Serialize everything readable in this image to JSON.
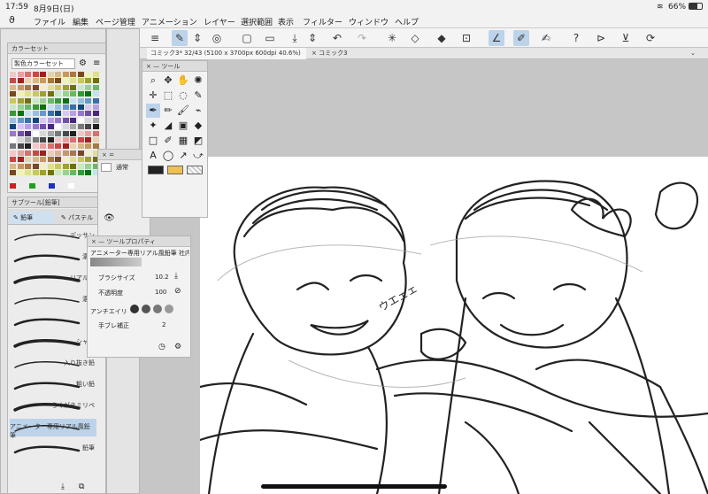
{
  "status": {
    "time": "17:59",
    "date": "8月9日(日)",
    "battery": "66%"
  },
  "menu": {
    "items": [
      "ファイル",
      "編集",
      "ページ管理",
      "アニメーション",
      "レイヤー",
      "選択範囲",
      "表示",
      "フィルター",
      "ウィンドウ",
      "ヘルプ"
    ]
  },
  "tabs": [
    {
      "label": "コミック3* 32/43 (5100 x 3700px 600dpi 40.6%)"
    },
    {
      "label": "コミック3"
    }
  ],
  "color_set": {
    "title": "カラーセット",
    "selector": "製色カラーセット",
    "colors": [
      "#f0c8c8",
      "#e8a0a0",
      "#d87070",
      "#c84848",
      "#a02020",
      "#e8d0b0",
      "#d8b888",
      "#c89860",
      "#a87840",
      "#784820",
      "#f0f0c0",
      "#e0e090",
      "#c8c860",
      "#a0a030",
      "#707010",
      "#c8e8c8",
      "#98d098",
      "#68b868",
      "#389838",
      "#107010",
      "#c8e0f0",
      "#98c0e0",
      "#6898c8",
      "#3870a8",
      "#104878",
      "#d8c8f0",
      "#b8a0e0",
      "#9878c8",
      "#7050a8",
      "#482878",
      "#ffffff",
      "#d8d8d8",
      "#a8a8a8",
      "#787878",
      "#484848",
      "#202020"
    ],
    "bottom_colors": [
      "#cc2020",
      "#20a020",
      "#2030c0",
      "#ffffff"
    ]
  },
  "subtool": {
    "title": "サブツール[鉛筆]",
    "tab_pencil": "鉛筆",
    "tab_pastel": "パステル",
    "brushes": [
      {
        "label": "デッサン"
      },
      {
        "label": "濃い"
      },
      {
        "label": "リアル鉛"
      },
      {
        "label": "濃い"
      },
      {
        "label": "色"
      },
      {
        "label": "シャー"
      },
      {
        "label": "入り抜き鉛"
      },
      {
        "label": "粗い鉛"
      },
      {
        "label": "らくがきミリペ"
      },
      {
        "label": "アニメーター専用リアル風鉛筆"
      },
      {
        "label": "鉛筆"
      }
    ],
    "selected_index": 9
  },
  "tool_palette": {
    "title": "ツール",
    "icons": [
      "magnifier-icon",
      "hand-move-icon",
      "hand-icon",
      "magic-wand-icon",
      "move-icon",
      "rect-select-icon",
      "lasso-icon",
      "eyedropper-icon",
      "pen-icon",
      "pencil-icon",
      "brush-icon",
      "airbrush-icon",
      "decoration-icon",
      "eraser-icon",
      "gradient-icon",
      "fill-icon",
      "figure-icon",
      "ruler-icon",
      "frame-icon",
      "operation-icon",
      "text-icon",
      "balloon-icon",
      "line-icon",
      "correction-icon"
    ],
    "selected_index": 8,
    "main_color": "#222222",
    "sub_color": "#f0c050"
  },
  "layer": {
    "blend": "通常",
    "layer_label": "レイヤー"
  },
  "tool_property": {
    "title": "ツールプロパティ",
    "brush_name": "アニメーター専用リアル風鉛筆 社内の人監修",
    "brush_size_label": "ブラシサイズ",
    "brush_size_value": "10.2",
    "opacity_label": "不透明度",
    "opacity_value": "100",
    "antialias_label": "アンチエイリ",
    "stabilization_label": "手ブレ補正",
    "stabilization_value": "2"
  },
  "canvas": {
    "onomatopoeia": "ウエェェ"
  },
  "accent": "#bcd3ea"
}
